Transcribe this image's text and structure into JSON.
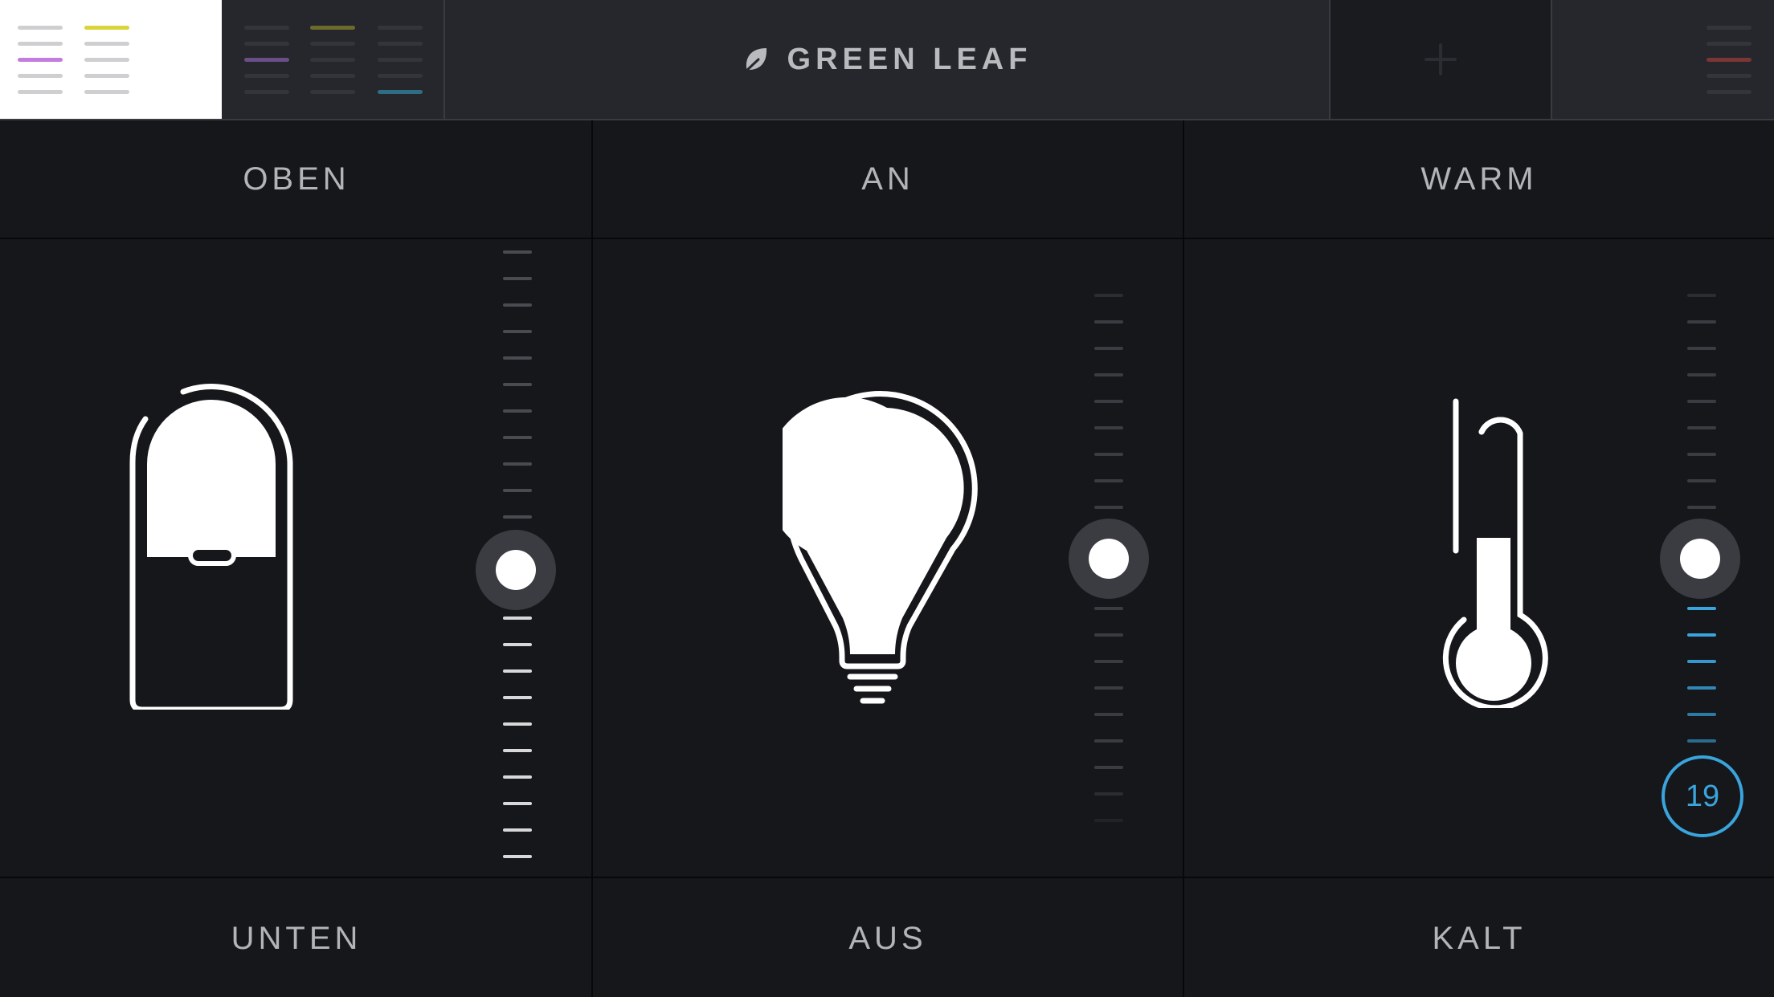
{
  "app": {
    "title": "GREEN LEAF"
  },
  "header": {
    "add_icon": "plus-icon",
    "leaf_icon": "leaf-icon",
    "tabs": [
      {
        "name": "room-tab-1",
        "accent": "#c47ddf",
        "accent2": "#d8d43a"
      },
      {
        "name": "room-tab-2",
        "accent": "#6a4f86",
        "accent2": "#6b6b2c",
        "accent3": "#2e6d82"
      },
      {
        "name": "room-tab-3",
        "accent": "#7a3535"
      }
    ]
  },
  "controls": {
    "blinds": {
      "top_label": "OBEN",
      "bottom_label": "UNTEN",
      "icon": "blinds-icon",
      "level": 0.5
    },
    "light": {
      "top_label": "AN",
      "bottom_label": "AUS",
      "icon": "lightbulb-icon",
      "level": 0.5
    },
    "temperature": {
      "top_label": "WARM",
      "bottom_label": "KALT",
      "icon": "thermometer-icon",
      "value": "19",
      "accent": "#3aa4dc"
    }
  }
}
